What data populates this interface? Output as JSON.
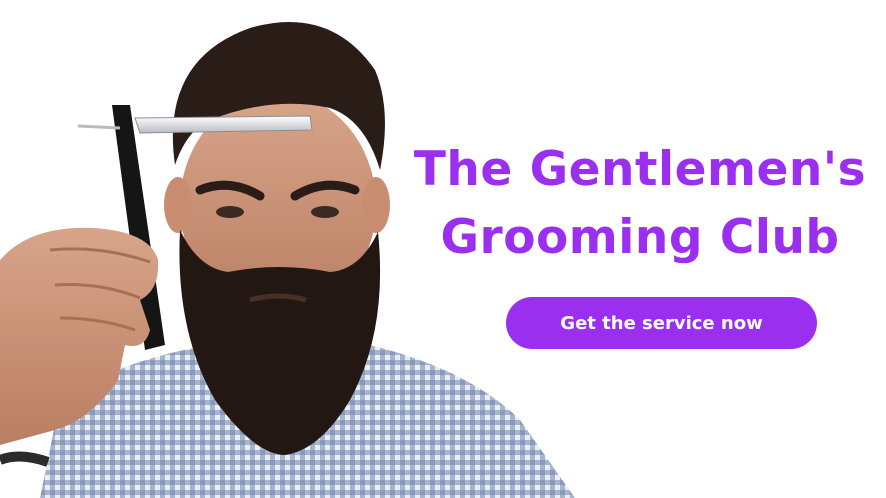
{
  "hero": {
    "title": "The Gentlemen's Grooming Club",
    "cta_label": "Get the service now"
  },
  "colors": {
    "accent": "#9b2ff0",
    "background": "#ffffff",
    "button_text": "#ffffff"
  },
  "image": {
    "subject": "bearded-man-with-straight-razor-photo"
  }
}
